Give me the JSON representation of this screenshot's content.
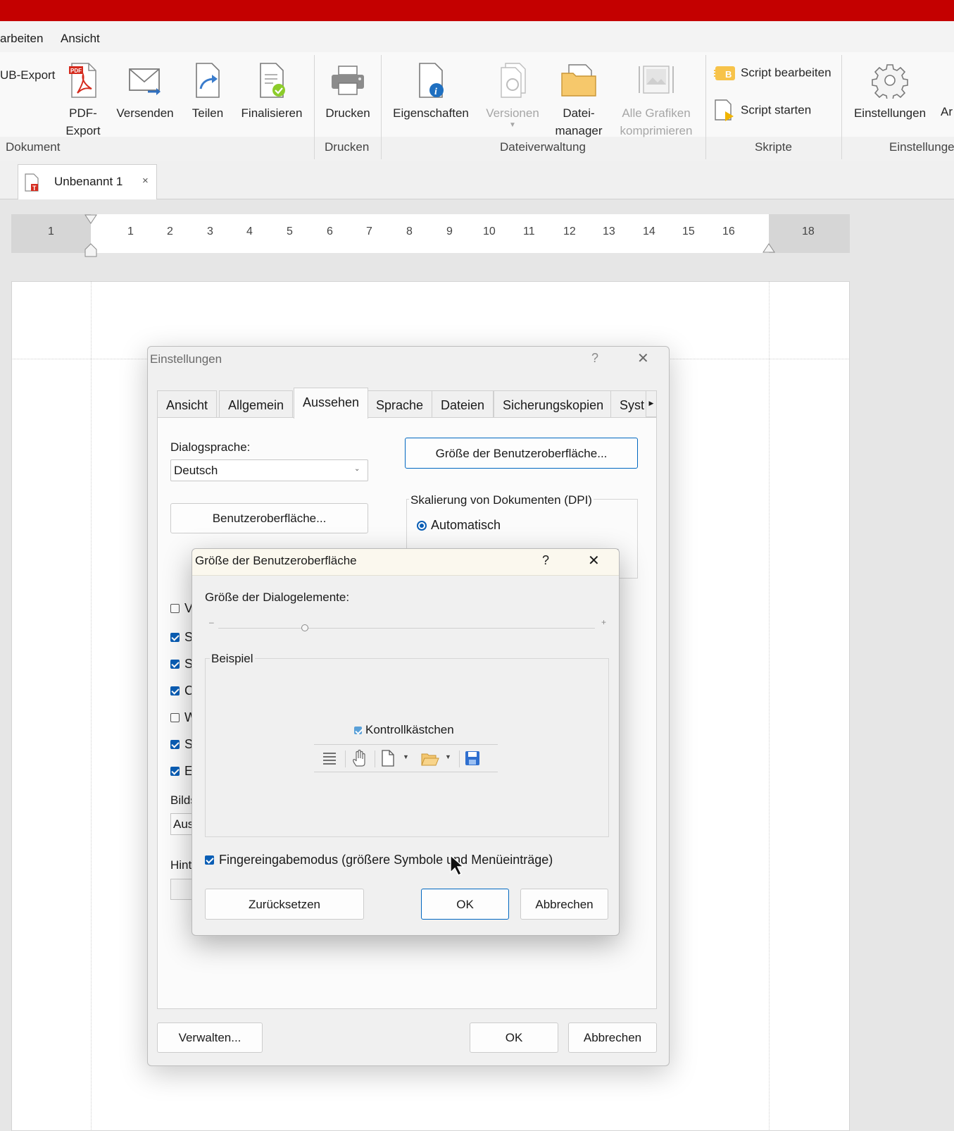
{
  "menu": {
    "items": [
      "arbeiten",
      "Ansicht"
    ]
  },
  "ribbon": {
    "epub_label": "UB-Export",
    "pdf_export": "PDF-Export",
    "pdf_export_l1": "PDF-",
    "pdf_export_l2": "Export",
    "versenden": "Versenden",
    "teilen": "Teilen",
    "finalisieren": "Finalisieren",
    "drucken": "Drucken",
    "eigenschaften": "Eigenschaften",
    "versionen": "Versionen",
    "dateimanager_l1": "Datei-",
    "dateimanager_l2": "manager",
    "grafiken_l1": "Alle Grafiken",
    "grafiken_l2": "komprimieren",
    "script_bearbeiten": "Script bearbeiten",
    "script_starten": "Script starten",
    "einstellungen": "Einstellungen",
    "cut_label": "Ar",
    "groups": {
      "dokument": "Dokument",
      "drucken": "Drucken",
      "dateiverwaltung": "Dateiverwaltung",
      "skripte": "Skripte",
      "einstellungen": "Einstellunge"
    }
  },
  "doc_tab": {
    "title": "Unbenannt 1",
    "close": "×"
  },
  "ruler": {
    "labels": [
      "1",
      "1",
      "2",
      "3",
      "4",
      "5",
      "6",
      "7",
      "8",
      "9",
      "10",
      "11",
      "12",
      "13",
      "14",
      "15",
      "16",
      "18"
    ]
  },
  "settings_dialog": {
    "title": "Einstellungen",
    "help": "?",
    "close": "✕",
    "tabs": [
      "Ansicht",
      "Allgemein",
      "Aussehen",
      "Sprache",
      "Dateien",
      "Sicherungskopien",
      "Syst"
    ],
    "active_tab": "Aussehen",
    "dialogsprache_label": "Dialogsprache:",
    "dialogsprache_value": "Deutsch",
    "benutzeroberflaeche_btn": "Benutzeroberfläche...",
    "groesse_btn": "Größe der Benutzeroberfläche...",
    "skalierung_label": "Skalierung von Dokumenten (DPI)",
    "automatisch": "Automatisch",
    "dpi_cut": "ı",
    "partial_checkboxes": [
      {
        "text": "V",
        "checked": false
      },
      {
        "text": "S",
        "checked": true
      },
      {
        "text": "S",
        "checked": true
      },
      {
        "text": "C",
        "checked": true
      },
      {
        "text": "W",
        "checked": false
      },
      {
        "text": "S",
        "checked": true
      },
      {
        "text": "E",
        "checked": true
      }
    ],
    "bilds_label": "Bilds",
    "aus_value": "Aus",
    "hint_label": "Hint",
    "verwalten_btn": "Verwalten...",
    "ok_btn": "OK",
    "abbrechen_btn": "Abbrechen"
  },
  "size_dialog": {
    "title": "Größe der Benutzeroberfläche",
    "help": "?",
    "close": "✕",
    "slider_label": "Größe der Dialogelemente:",
    "slider_minus": "–",
    "slider_plus": "+",
    "slider_value": 0.23,
    "example_label": "Beispiel",
    "example_checkbox": "Kontrollkästchen",
    "touch_mode_label": "Fingereingabemodus (größere Symbole und Menüeinträge)",
    "touch_mode_checked": true,
    "reset_btn": "Zurücksetzen",
    "ok_btn": "OK",
    "cancel_btn": "Abbrechen"
  },
  "colors": {
    "titlebar": "#c40000",
    "accent": "#0067c0",
    "checkbox": "#0a5eb5"
  }
}
